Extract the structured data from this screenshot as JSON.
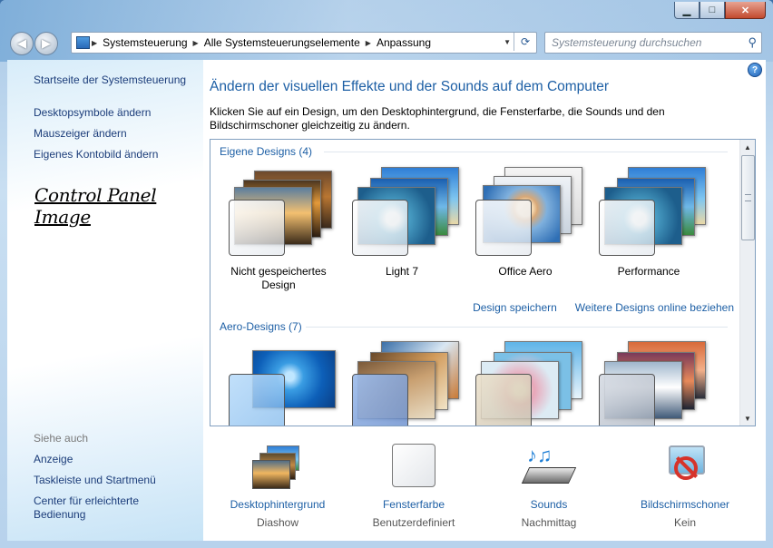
{
  "window": {
    "min_glyph": "▁",
    "max_glyph": "□",
    "close_glyph": "✕",
    "back_glyph": "◀",
    "forward_glyph": "▶"
  },
  "address": {
    "crumbs": [
      "Systemsteuerung",
      "Alle Systemsteuerungselemente",
      "Anpassung"
    ],
    "separator": "▶",
    "dropdown_glyph": "▼",
    "refresh_glyph": "⟳"
  },
  "search": {
    "placeholder": "Systemsteuerung durchsuchen",
    "icon_glyph": "⚲"
  },
  "sidebar": {
    "home": "Startseite der Systemsteuerung",
    "links": [
      "Desktopsymbole ändern",
      "Mauszeiger ändern",
      "Eigenes Kontobild ändern"
    ],
    "caption": "Control Panel Image",
    "see_also_title": "Siehe auch",
    "see_also": [
      "Anzeige",
      "Taskleiste und Startmenü",
      "Center für erleichterte Bedienung"
    ]
  },
  "main": {
    "help_glyph": "?",
    "heading": "Ändern der visuellen Effekte und der Sounds auf dem Computer",
    "description": "Klicken Sie auf ein Design, um den Desktophintergrund, die Fensterfarbe, die Sounds und den Bildschirmschoner gleichzeitig zu ändern."
  },
  "gallery": {
    "my_designs_title": "Eigene Designs (4)",
    "my_designs": [
      {
        "name": "Nicht gespeichertes Design",
        "icon": "sunset-landscape"
      },
      {
        "name": "Light 7",
        "icon": "palm-island"
      },
      {
        "name": "Office Aero",
        "icon": "woman-portrait"
      },
      {
        "name": "Performance",
        "icon": "palm-island"
      }
    ],
    "save_link": "Design speichern",
    "more_link": "Weitere Designs online beziehen",
    "aero_title": "Aero-Designs (7)",
    "aero_designs": [
      {
        "icon": "windows-7-logo"
      },
      {
        "icon": "architecture"
      },
      {
        "icon": "flowers"
      },
      {
        "icon": "landscapes"
      }
    ],
    "scroll_up_glyph": "▲",
    "scroll_down_glyph": "▼"
  },
  "bottom": [
    {
      "title": "Desktophintergrund",
      "sub": "Diashow",
      "icon": "photo-stack-icon"
    },
    {
      "title": "Fensterfarbe",
      "sub": "Benutzerdefiniert",
      "icon": "color-swatch-icon"
    },
    {
      "title": "Sounds",
      "sub": "Nachmittag",
      "icon": "music-notes-icon"
    },
    {
      "title": "Bildschirmschoner",
      "sub": "Kein",
      "icon": "no-screensaver-icon"
    }
  ]
}
